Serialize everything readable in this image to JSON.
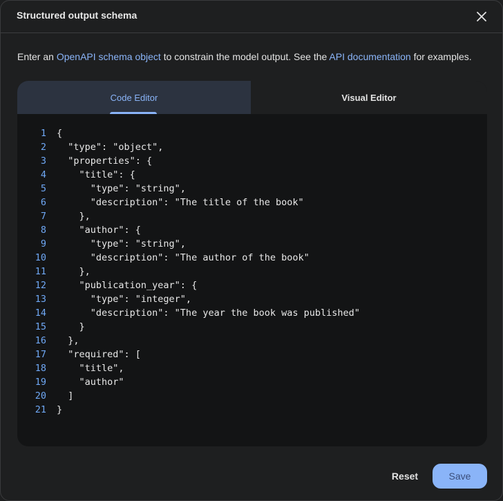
{
  "dialog": {
    "title": "Structured output schema",
    "close_icon": "close-icon"
  },
  "description": {
    "part1": "Enter an ",
    "link1": "OpenAPI schema object",
    "part2": " to constrain the model output. See the ",
    "link2": "API documentation",
    "part3": " for examples."
  },
  "tabs": [
    {
      "label": "Code Editor",
      "active": true
    },
    {
      "label": "Visual Editor",
      "active": false
    }
  ],
  "code_lines": [
    "{",
    "  \"type\": \"object\",",
    "  \"properties\": {",
    "    \"title\": {",
    "      \"type\": \"string\",",
    "      \"description\": \"The title of the book\"",
    "    },",
    "    \"author\": {",
    "      \"type\": \"string\",",
    "      \"description\": \"The author of the book\"",
    "    },",
    "    \"publication_year\": {",
    "      \"type\": \"integer\",",
    "      \"description\": \"The year the book was published\"",
    "    }",
    "  },",
    "  \"required\": [",
    "    \"title\",",
    "    \"author\"",
    "  ]",
    "}"
  ],
  "line_numbers": [
    "1",
    "2",
    "3",
    "4",
    "5",
    "6",
    "7",
    "8",
    "9",
    "10",
    "11",
    "12",
    "13",
    "14",
    "15",
    "16",
    "17",
    "18",
    "19",
    "20",
    "21"
  ],
  "buttons": {
    "reset": "Reset",
    "save": "Save"
  },
  "colors": {
    "accent": "#8ab4f8",
    "background": "#1e1f20",
    "editor_bg": "#131415"
  }
}
